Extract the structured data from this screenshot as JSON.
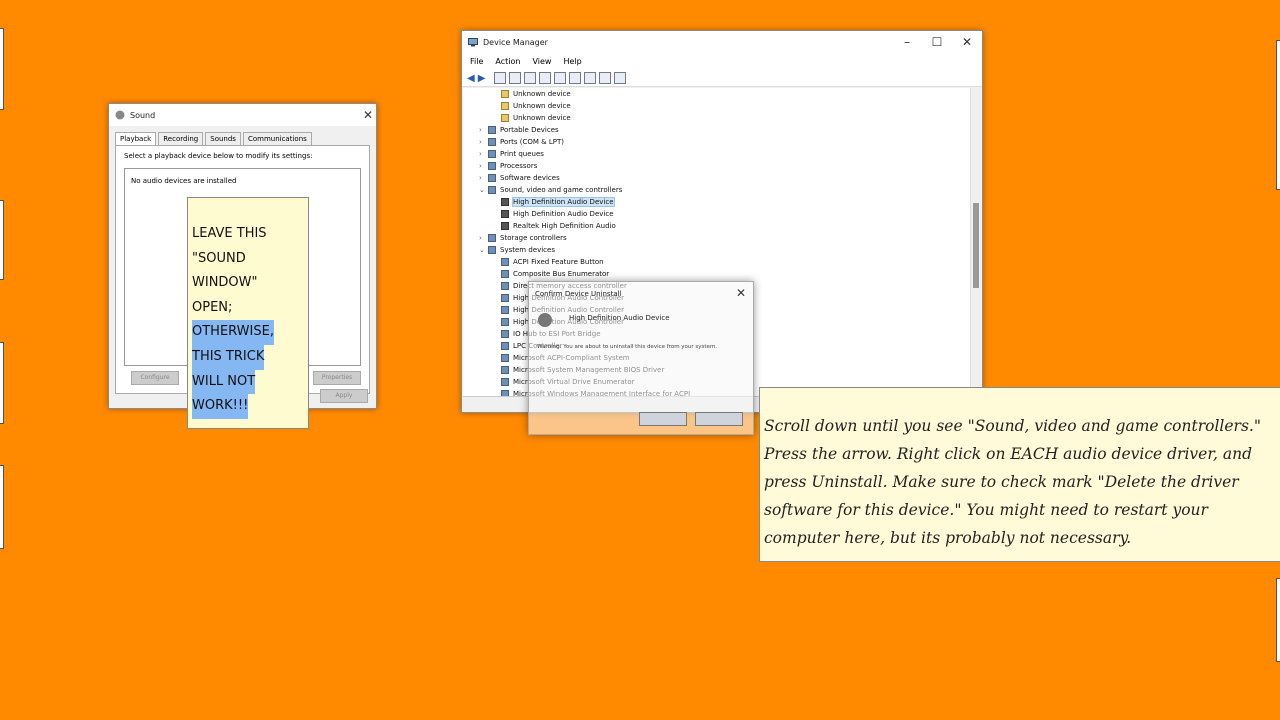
{
  "sound_window": {
    "title": "Sound",
    "tabs": [
      "Playback",
      "Recording",
      "Sounds",
      "Communications"
    ],
    "hint": "Select a playback device below to modify its settings:",
    "empty_text": "No audio devices are installed",
    "configure_label": "Configure",
    "properties_label": "Properties",
    "apply_label": "Apply"
  },
  "note_left": {
    "lines": [
      "LEAVE THIS",
      "\"SOUND",
      "WINDOW\"",
      "OPEN;",
      "OTHERWISE,",
      "THIS TRICK",
      "WILL NOT",
      "WORK!!!"
    ]
  },
  "device_manager": {
    "title": "Device Manager",
    "menu": [
      "File",
      "Action",
      "View",
      "Help"
    ],
    "tree": [
      {
        "label": "Unknown device",
        "level": 2,
        "icon": "unknown-device-icon"
      },
      {
        "label": "Unknown device",
        "level": 2,
        "icon": "unknown-device-icon"
      },
      {
        "label": "Unknown device",
        "level": 2,
        "icon": "unknown-device-icon"
      },
      {
        "label": "Portable Devices",
        "level": 1,
        "arrow": "collapsed"
      },
      {
        "label": "Ports (COM & LPT)",
        "level": 1,
        "arrow": "collapsed"
      },
      {
        "label": "Print queues",
        "level": 1,
        "arrow": "collapsed"
      },
      {
        "label": "Processors",
        "level": 1,
        "arrow": "collapsed"
      },
      {
        "label": "Software devices",
        "level": 1,
        "arrow": "collapsed"
      },
      {
        "label": "Sound, video and game controllers",
        "level": 1,
        "arrow": "expanded"
      },
      {
        "label": "High Definition Audio Device",
        "level": 2,
        "icon": "speaker-icon",
        "selected": true
      },
      {
        "label": "High Definition Audio Device",
        "level": 2,
        "icon": "speaker-icon"
      },
      {
        "label": "Realtek High Definition Audio",
        "level": 2,
        "icon": "speaker-icon"
      },
      {
        "label": "Storage controllers",
        "level": 1,
        "arrow": "collapsed"
      },
      {
        "label": "System devices",
        "level": 1,
        "arrow": "expanded"
      },
      {
        "label": "ACPI Fixed Feature Button",
        "level": 2
      },
      {
        "label": "Composite Bus Enumerator",
        "level": 2
      },
      {
        "label": "Direct memory access controller",
        "level": 2
      },
      {
        "label": "High Definition Audio Controller",
        "level": 2
      },
      {
        "label": "High Definition Audio Controller",
        "level": 2
      },
      {
        "label": "High Definition Audio Controller",
        "level": 2
      },
      {
        "label": "IO Hub to ESI Port Bridge",
        "level": 2
      },
      {
        "label": "LPC Controller",
        "level": 2
      },
      {
        "label": "Microsoft ACPI-Compliant System",
        "level": 2
      },
      {
        "label": "Microsoft System Management BIOS Driver",
        "level": 2
      },
      {
        "label": "Microsoft Virtual Drive Enumerator",
        "level": 2
      },
      {
        "label": "Microsoft Windows Management Interface for ACPI",
        "level": 2
      }
    ]
  },
  "confirm_dialog": {
    "title": "Confirm Device Uninstall",
    "device_name": "High Definition Audio Device",
    "warning": "Warning: You are about to uninstall this device from your system."
  },
  "note_right": {
    "text": "Scroll down until you see \"Sound, video and game controllers.\" Press the arrow. Right click on EACH audio device driver, and press Uninstall. Make sure to check mark \"Delete the driver software for this device.\" You might need to restart your computer here, but its probably not necessary."
  }
}
